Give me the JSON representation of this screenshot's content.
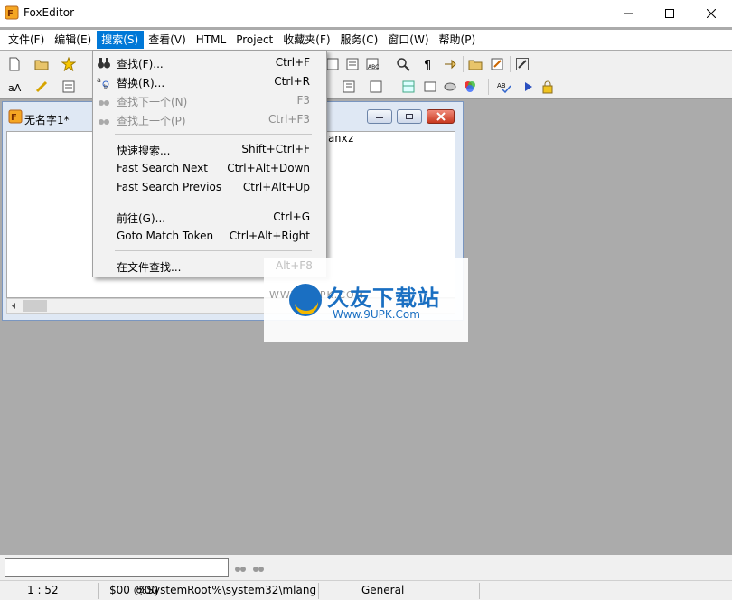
{
  "app": {
    "title": "FoxEditor",
    "icon": "fox-app-icon"
  },
  "window_controls": [
    "minimize-icon",
    "maximize-icon",
    "close-icon"
  ],
  "menubar": [
    {
      "label": "文件(F)"
    },
    {
      "label": "编辑(E)"
    },
    {
      "label": "搜索(S)",
      "active": true
    },
    {
      "label": "查看(V)"
    },
    {
      "label": "HTML"
    },
    {
      "label": "Project"
    },
    {
      "label": "收藏夹(F)"
    },
    {
      "label": "服务(C)"
    },
    {
      "label": "窗口(W)"
    },
    {
      "label": "帮助(P)"
    }
  ],
  "search_menu": {
    "items": [
      {
        "label": "查找(F)...",
        "shortcut": "Ctrl+F",
        "icon": "binoculars-icon",
        "enabled": true
      },
      {
        "label": "替换(R)...",
        "shortcut": "Ctrl+R",
        "icon": "replace-icon",
        "enabled": true
      },
      {
        "label": "查找下一个(N)",
        "shortcut": "F3",
        "icon": "find-next-icon",
        "enabled": false
      },
      {
        "label": "查找上一个(P)",
        "shortcut": "Ctrl+F3",
        "icon": "find-prev-icon",
        "enabled": false
      },
      {
        "label": "快速搜索...",
        "shortcut": "Shift+Ctrl+F",
        "enabled": true
      },
      {
        "label": "Fast Search Next",
        "shortcut": "Ctrl+Alt+Down",
        "enabled": true
      },
      {
        "label": "Fast Search Previos",
        "shortcut": "Ctrl+Alt+Up",
        "enabled": true
      },
      {
        "label": "前往(G)...",
        "shortcut": "Ctrl+G",
        "enabled": true
      },
      {
        "label": "Goto Match Token",
        "shortcut": "Ctrl+Alt+Right",
        "enabled": true
      },
      {
        "label": "在文件查找...",
        "shortcut": "",
        "enabled": true
      }
    ]
  },
  "document": {
    "title": "无名字1*",
    "visible_text": "anxz"
  },
  "watermark": {
    "hint": "Alt+F8",
    "left_text": "WWW.9UPK.COM",
    "brand": "久友下载站",
    "url": "Www.9UPK.Com"
  },
  "statusbar": {
    "position": "1 : 52",
    "info": "$00 @00",
    "path": "%SystemRoot%\\system32\\mlang",
    "mode": "General"
  },
  "colors": {
    "accent": "#0078d7",
    "workspace": "#ababab",
    "watermark_blue": "#1a6fc2"
  }
}
